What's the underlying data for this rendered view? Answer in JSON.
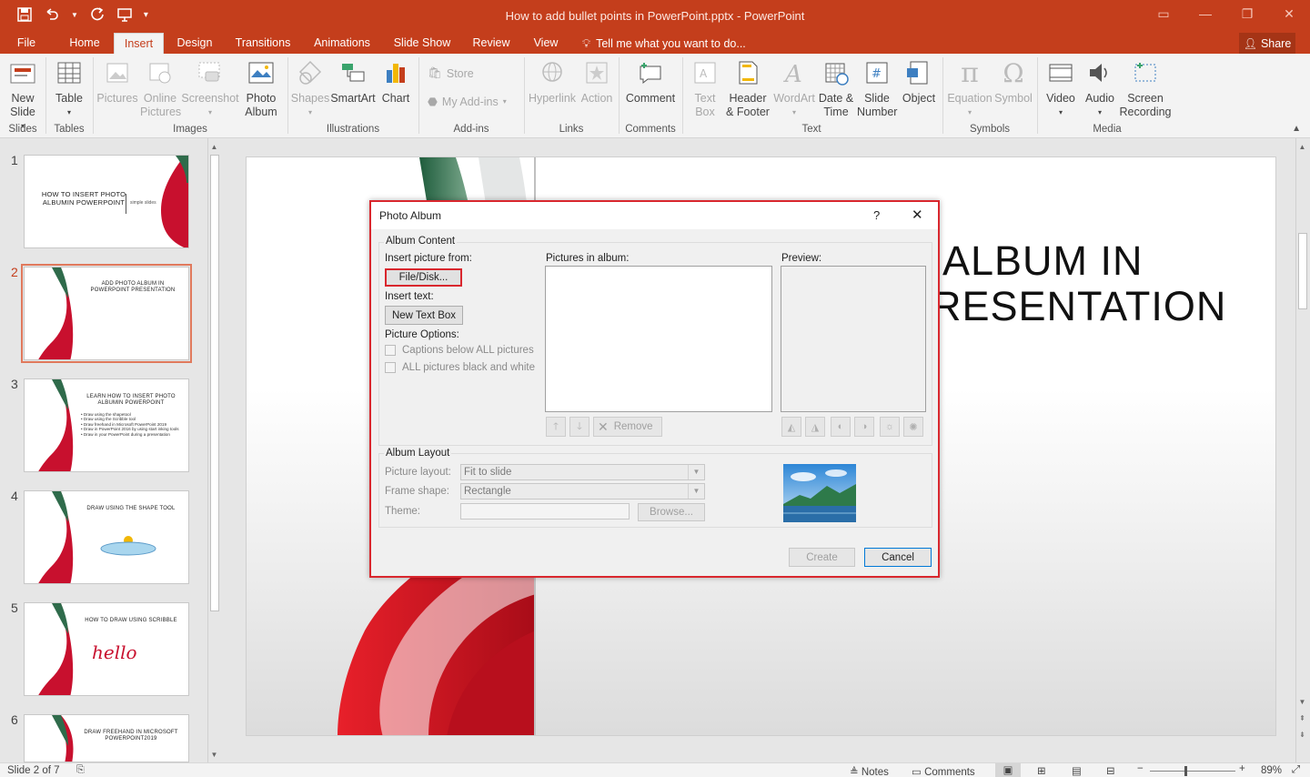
{
  "window": {
    "title": "How to add bullet points in PowerPoint.pptx - PowerPoint",
    "accent": "#c43e1c"
  },
  "menu": {
    "tabs": [
      "File",
      "Home",
      "Insert",
      "Design",
      "Transitions",
      "Animations",
      "Slide Show",
      "Review",
      "View"
    ],
    "active": "Insert",
    "tellme": "Tell me what you want to do...",
    "share": "Share"
  },
  "ribbon": {
    "slides": {
      "new_slide": "New Slide",
      "group": "Slides"
    },
    "tables": {
      "table": "Table",
      "group": "Tables"
    },
    "images": {
      "pictures": "Pictures",
      "online_pictures": "Online Pictures",
      "screenshot": "Screenshot",
      "photo_album": "Photo Album",
      "group": "Images"
    },
    "illustrations": {
      "shapes": "Shapes",
      "smartart": "SmartArt",
      "chart": "Chart",
      "group": "Illustrations"
    },
    "addins": {
      "store": "Store",
      "my_addins": "My Add-ins",
      "group": "Add-ins"
    },
    "links": {
      "hyperlink": "Hyperlink",
      "action": "Action",
      "group": "Links"
    },
    "comments": {
      "comment": "Comment",
      "group": "Comments"
    },
    "text": {
      "text_box": "Text Box",
      "header_footer": "Header & Footer",
      "wordart": "WordArt",
      "date_time": "Date & Time",
      "slide_number": "Slide Number",
      "object": "Object",
      "group": "Text"
    },
    "symbols": {
      "equation": "Equation",
      "symbol": "Symbol",
      "group": "Symbols"
    },
    "media": {
      "video": "Video",
      "audio": "Audio",
      "screen_recording": "Screen Recording",
      "group": "Media"
    }
  },
  "thumbnails": [
    {
      "num": "1",
      "title": "HOW TO INSERT PHOTO ALBUMIN POWERPOINT",
      "brand": "simple slides"
    },
    {
      "num": "2",
      "title": "ADD PHOTO ALBUM IN POWERPOINT PRESENTATION"
    },
    {
      "num": "3",
      "title": "LEARN HOW TO INSERT PHOTO ALBUMIN POWERPOINT",
      "bullets": "• Draw using the shapetool\n• Draw using the Scribble tool\n• Draw freehand in Microsoft PowerPoint 2019\n• Draw in PowerPoint 2016 by using start inking tools\n• Draw in your PowerPoint during a presentation"
    },
    {
      "num": "4",
      "title": "DRAW USING THE SHAPE TOOL"
    },
    {
      "num": "5",
      "title": "HOW TO DRAW USING SCRIBBLE",
      "hello": "hello"
    },
    {
      "num": "6",
      "title": "DRAW FREEHAND IN MICROSOFT POWERPOINT2019"
    }
  ],
  "slide": {
    "title_line1": "ALBUM IN",
    "title_line2": "RESENTATION"
  },
  "dialog": {
    "title": "Photo Album",
    "help": "?",
    "album_content": "Album Content",
    "insert_picture_from": "Insert picture from:",
    "file_disk": "File/Disk...",
    "insert_text": "Insert text:",
    "new_text_box": "New Text Box",
    "picture_options": "Picture Options:",
    "captions_below": "Captions below ALL pictures",
    "black_white": "ALL pictures black and white",
    "pictures_in_album": "Pictures in album:",
    "preview": "Preview:",
    "remove": "Remove",
    "album_layout": "Album Layout",
    "picture_layout_label": "Picture layout:",
    "picture_layout_value": "Fit to slide",
    "frame_shape_label": "Frame shape:",
    "frame_shape_value": "Rectangle",
    "theme_label": "Theme:",
    "browse": "Browse...",
    "create": "Create",
    "cancel": "Cancel",
    "highlight_color": "#d9272e"
  },
  "status": {
    "slide_of": "Slide 2 of 7",
    "notes": "Notes",
    "comments": "Comments",
    "zoom": "89%"
  }
}
